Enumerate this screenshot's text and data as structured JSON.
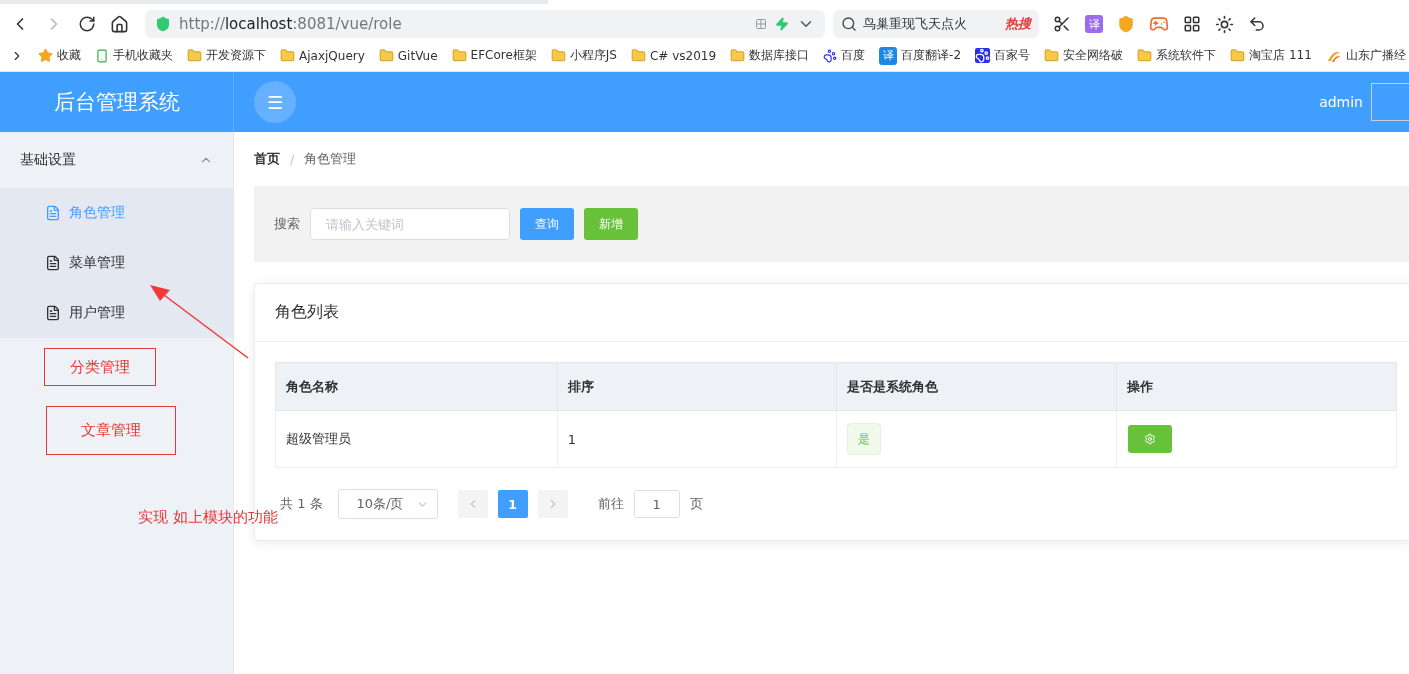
{
  "browser": {
    "forward_disabled": true,
    "address": {
      "scheme": "http://",
      "host": "localhost",
      "rest": ":8081/vue/role"
    },
    "search": {
      "text": "鸟巢重现飞天点火",
      "badge": "热搜"
    },
    "translate_label": "译"
  },
  "bookmarks": [
    {
      "label": "收藏",
      "kind": "star"
    },
    {
      "label": "手机收藏夹",
      "kind": "phone"
    },
    {
      "label": "开发资源下",
      "kind": "folder"
    },
    {
      "label": "AjaxjQuery",
      "kind": "folder"
    },
    {
      "label": "GitVue",
      "kind": "folder"
    },
    {
      "label": "EFCore框架",
      "kind": "folder"
    },
    {
      "label": "小程序JS",
      "kind": "folder"
    },
    {
      "label": "C# vs2019",
      "kind": "folder"
    },
    {
      "label": "数据库接口",
      "kind": "folder"
    },
    {
      "label": "百度",
      "kind": "paw"
    },
    {
      "label": "百度翻译-2",
      "kind": "translate",
      "icon_text": "译"
    },
    {
      "label": "百家号",
      "kind": "pawbox"
    },
    {
      "label": "安全网络破",
      "kind": "folder"
    },
    {
      "label": "系统软件下",
      "kind": "folder"
    },
    {
      "label": "淘宝店 111",
      "kind": "folder"
    },
    {
      "label": "山东广播经",
      "kind": "logo"
    }
  ],
  "header": {
    "title": "后台管理系统",
    "menu_glyph": "☰",
    "user": "admin"
  },
  "sidebar": {
    "group": {
      "label": "基础设置",
      "expanded": true
    },
    "items": [
      {
        "label": "角色管理",
        "selected": true
      },
      {
        "label": "菜单管理",
        "selected": false
      },
      {
        "label": "用户管理",
        "selected": false
      }
    ]
  },
  "annotations": {
    "boxes": [
      "分类管理",
      "文章管理"
    ],
    "note": "实现 如上模块的功能"
  },
  "breadcrumb": {
    "separator": "/",
    "items": [
      "首页",
      "角色管理"
    ]
  },
  "search_panel": {
    "label": "搜索",
    "placeholder": "请输入关键词",
    "buttons": [
      {
        "label": "查询",
        "kind": "primary"
      },
      {
        "label": "新增",
        "kind": "success"
      }
    ]
  },
  "card": {
    "title": "角色列表",
    "table": {
      "columns": [
        "角色名称",
        "排序",
        "是否是系统角色",
        "操作"
      ],
      "rows": [
        {
          "name": "超级管理员",
          "sort": "1",
          "system": "是"
        }
      ]
    },
    "pagination": {
      "total": "共 1 条",
      "page_size": "10条/页",
      "pages": [
        {
          "label": "1",
          "selected": true
        }
      ],
      "goto": "前往",
      "goto_value": "1",
      "suffix": "页"
    }
  }
}
